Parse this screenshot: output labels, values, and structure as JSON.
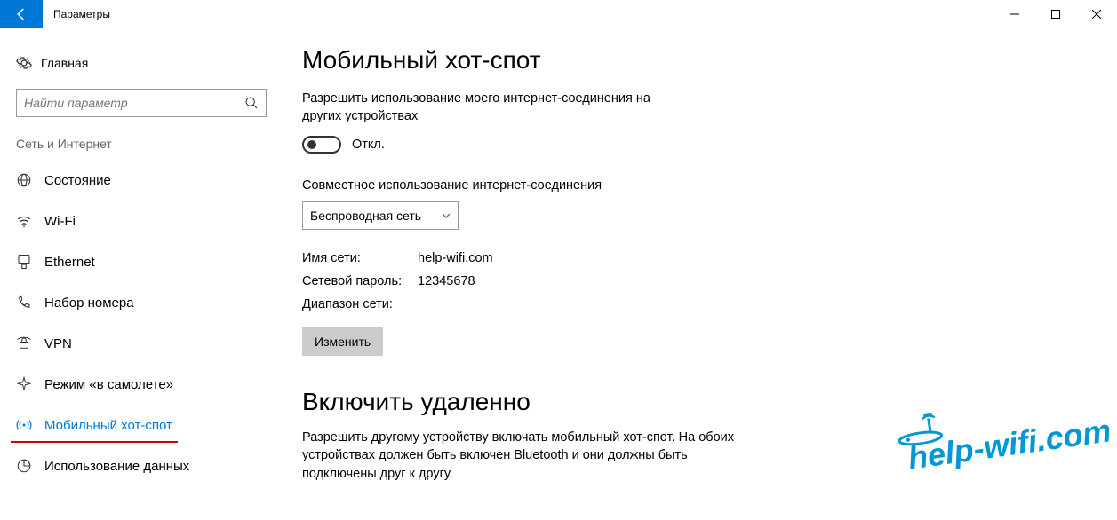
{
  "window": {
    "title": "Параметры"
  },
  "sidebar": {
    "home": "Главная",
    "search_placeholder": "Найти параметр",
    "category": "Сеть и Интернет",
    "items": [
      {
        "label": "Состояние"
      },
      {
        "label": "Wi-Fi"
      },
      {
        "label": "Ethernet"
      },
      {
        "label": "Набор номера"
      },
      {
        "label": "VPN"
      },
      {
        "label": "Режим «в самолете»"
      },
      {
        "label": "Мобильный хот-спот"
      },
      {
        "label": "Использование данных"
      }
    ]
  },
  "main": {
    "heading": "Мобильный хот-спот",
    "share_desc": "Разрешить использование моего интернет-соединения на других устройствах",
    "toggle_state": "Откл.",
    "share_from_label": "Совместное использование интернет-соединения",
    "share_from_value": "Беспроводная сеть",
    "net_name_label": "Имя сети:",
    "net_name_value": "help-wifi.com",
    "net_pass_label": "Сетевой пароль:",
    "net_pass_value": "12345678",
    "net_band_label": "Диапазон сети:",
    "net_band_value": "",
    "edit_btn": "Изменить",
    "remote_heading": "Включить удаленно",
    "remote_desc": "Разрешить другому устройству включать мобильный хот-спот. На обоих устройствах должен быть включен Bluetooth и они должны быть подключены друг к другу."
  },
  "watermark": "help-wifi.com"
}
